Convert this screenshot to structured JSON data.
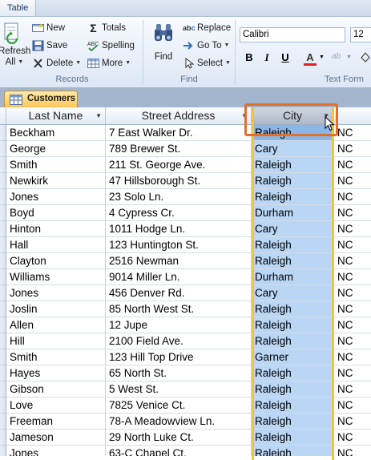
{
  "window": {
    "context_tab": "Table"
  },
  "ribbon": {
    "records": {
      "refresh_label_line1": "Refresh",
      "refresh_label_line2": "All",
      "new_label": "New",
      "save_label": "Save",
      "delete_label": "Delete",
      "totals_label": "Totals",
      "spelling_label": "Spelling",
      "more_label": "More",
      "group_label": "Records"
    },
    "find": {
      "find_label": "Find",
      "replace_label": "Replace",
      "goto_label": "Go To",
      "select_label": "Select",
      "group_label": "Find"
    },
    "text_formatting": {
      "font_name": "Calibri",
      "font_size": "12",
      "bold_label": "B",
      "italic_label": "I",
      "underline_label": "U",
      "font_color_label": "A",
      "group_label": "Text Form"
    }
  },
  "document": {
    "tab_label": "Customers"
  },
  "table": {
    "columns": [
      "Last Name",
      "Street Address",
      "City"
    ],
    "rows": [
      [
        "Beckham",
        "7 East Walker Dr.",
        "Raleigh",
        "NC"
      ],
      [
        "George",
        "789 Brewer St.",
        "Cary",
        "NC"
      ],
      [
        "Smith",
        "211 St. George Ave.",
        "Raleigh",
        "NC"
      ],
      [
        "Newkirk",
        "47 Hillsborough St.",
        "Raleigh",
        "NC"
      ],
      [
        "Jones",
        "23 Solo Ln.",
        "Raleigh",
        "NC"
      ],
      [
        "Boyd",
        "4 Cypress Cr.",
        "Durham",
        "NC"
      ],
      [
        "Hinton",
        "1011 Hodge Ln.",
        "Cary",
        "NC"
      ],
      [
        "Hall",
        "123 Huntington St.",
        "Raleigh",
        "NC"
      ],
      [
        "Clayton",
        "2516 Newman",
        "Raleigh",
        "NC"
      ],
      [
        "Williams",
        "9014 Miller Ln.",
        "Durham",
        "NC"
      ],
      [
        "Jones",
        "456 Denver Rd.",
        "Cary",
        "NC"
      ],
      [
        "Joslin",
        "85 North West St.",
        "Raleigh",
        "NC"
      ],
      [
        "Allen",
        "12 Jupe",
        "Raleigh",
        "NC"
      ],
      [
        "Hill",
        "2100 Field Ave.",
        "Raleigh",
        "NC"
      ],
      [
        "Smith",
        "123 Hill Top Drive",
        "Garner",
        "NC"
      ],
      [
        "Hayes",
        "65 North St.",
        "Raleigh",
        "NC"
      ],
      [
        "Gibson",
        "5 West St.",
        "Raleigh",
        "NC"
      ],
      [
        "Love",
        "7825 Venice Ct.",
        "Raleigh",
        "NC"
      ],
      [
        "Freeman",
        "78-A Meadowview Ln.",
        "Raleigh",
        "NC"
      ],
      [
        "Jameson",
        "29 North Luke Ct.",
        "Raleigh",
        "NC"
      ],
      [
        "Jones",
        "63-C Chapel Ct.",
        "Raleigh",
        "NC"
      ]
    ],
    "selected_column": "City"
  },
  "colors": {
    "selected_column_fill": "#bad6f5",
    "selected_column_border": "#f3c53b",
    "highlight_callout": "#e0702a",
    "doc_tab": "#fcc65a"
  }
}
